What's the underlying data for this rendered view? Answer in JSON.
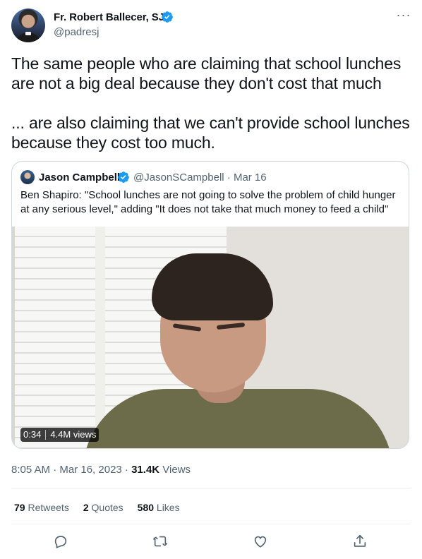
{
  "author": {
    "name": "Fr. Robert Ballecer, SJ",
    "handle": "@padresj"
  },
  "tweet": {
    "text": "The same people who are claiming that school lunches are not a big deal because they don't cost that much\n\n... are also claiming that we can't provide school lunches because they cost too much."
  },
  "quoted": {
    "name": "Jason Campbell",
    "handle_date": "@JasonSCampbell · Mar 16",
    "text": "Ben Shapiro: \"School lunches are not going to solve the problem of child hunger at any serious level,\" adding \"It does not take that much money to feed a child\"",
    "video": {
      "duration": "0:34",
      "views": "4.4M views"
    }
  },
  "meta": {
    "time_date": "8:05 AM · Mar 16, 2023 · ",
    "views_count": "31.4K",
    "views_label": " Views"
  },
  "stats": {
    "retweets_count": "79",
    "retweets_label": " Retweets",
    "quotes_count": "2",
    "quotes_label": " Quotes",
    "likes_count": "580",
    "likes_label": " Likes"
  },
  "colors": {
    "verified_blue": "#1d9bf0",
    "secondary_text": "#536471",
    "border": "#cfd9de"
  },
  "icons": [
    "more-icon",
    "verified-icon",
    "reply-icon",
    "retweet-icon",
    "like-icon",
    "share-icon"
  ]
}
